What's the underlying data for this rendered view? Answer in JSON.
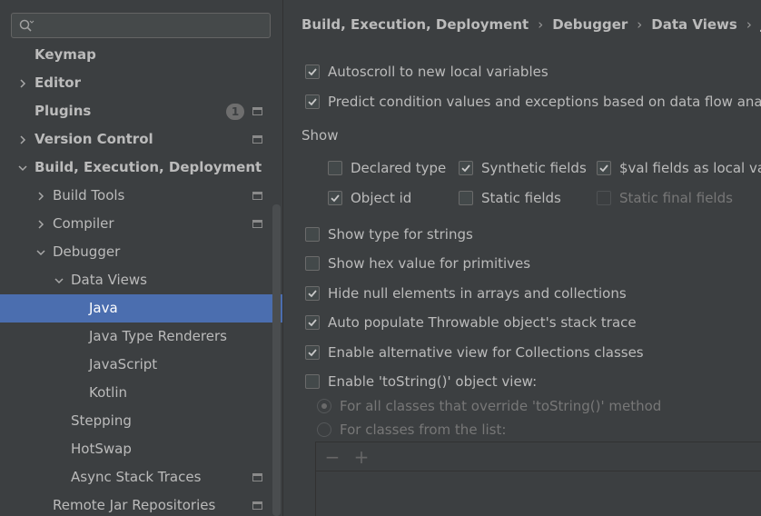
{
  "sidebar": {
    "search": {
      "placeholder": "",
      "value": ""
    },
    "items": [
      {
        "label": "Keymap",
        "level": 0,
        "bold": true,
        "chevron": "none",
        "icon": false
      },
      {
        "label": "Editor",
        "level": 0,
        "bold": true,
        "chevron": "right",
        "icon": false
      },
      {
        "label": "Plugins",
        "level": 0,
        "bold": true,
        "chevron": "none",
        "badge": "1",
        "icon": true
      },
      {
        "label": "Version Control",
        "level": 0,
        "bold": true,
        "chevron": "right",
        "icon": true
      },
      {
        "label": "Build, Execution, Deployment",
        "level": 0,
        "bold": true,
        "chevron": "down",
        "icon": false
      },
      {
        "label": "Build Tools",
        "level": 1,
        "bold": false,
        "chevron": "right",
        "icon": true
      },
      {
        "label": "Compiler",
        "level": 1,
        "bold": false,
        "chevron": "right",
        "icon": true
      },
      {
        "label": "Debugger",
        "level": 1,
        "bold": false,
        "chevron": "down",
        "icon": false
      },
      {
        "label": "Data Views",
        "level": 2,
        "bold": false,
        "chevron": "down",
        "icon": false
      },
      {
        "label": "Java",
        "level": 3,
        "bold": false,
        "chevron": "none",
        "icon": false,
        "selected": true
      },
      {
        "label": "Java Type Renderers",
        "level": 3,
        "bold": false,
        "chevron": "none",
        "icon": false
      },
      {
        "label": "JavaScript",
        "level": 3,
        "bold": false,
        "chevron": "none",
        "icon": false
      },
      {
        "label": "Kotlin",
        "level": 3,
        "bold": false,
        "chevron": "none",
        "icon": false
      },
      {
        "label": "Stepping",
        "level": 2,
        "bold": false,
        "chevron": "none",
        "icon": false
      },
      {
        "label": "HotSwap",
        "level": 2,
        "bold": false,
        "chevron": "none",
        "icon": false
      },
      {
        "label": "Async Stack Traces",
        "level": 2,
        "bold": false,
        "chevron": "none",
        "icon": true
      },
      {
        "label": "Remote Jar Repositories",
        "level": 1,
        "bold": false,
        "chevron": "none",
        "icon": true
      }
    ]
  },
  "breadcrumb": [
    "Build, Execution, Deployment",
    "Debugger",
    "Data Views",
    "Java"
  ],
  "options_top": [
    {
      "label": "Autoscroll to new local variables",
      "checked": true
    },
    {
      "label": "Predict condition values and exceptions based on data flow analysis",
      "checked": true
    }
  ],
  "show": {
    "title": "Show",
    "items": [
      {
        "label": "Declared type",
        "checked": false,
        "disabled": false
      },
      {
        "label": "Synthetic fields",
        "checked": true,
        "disabled": false
      },
      {
        "label": "$val fields as local variables",
        "checked": true,
        "disabled": false
      },
      {
        "label": "Object id",
        "checked": true,
        "disabled": false
      },
      {
        "label": "Static fields",
        "checked": false,
        "disabled": false
      },
      {
        "label": "Static final fields",
        "checked": false,
        "disabled": true
      }
    ]
  },
  "options_bottom": [
    {
      "label": "Show type for strings",
      "checked": false
    },
    {
      "label": "Show hex value for primitives",
      "checked": false
    },
    {
      "label": "Hide null elements in arrays and collections",
      "checked": true
    },
    {
      "label": "Auto populate Throwable object's stack trace",
      "checked": true
    },
    {
      "label": "Enable alternative view for Collections classes",
      "checked": true
    },
    {
      "label": "Enable 'toString()' object view:",
      "checked": false
    }
  ],
  "tostring_radios": [
    {
      "label": "For all classes that override 'toString()' method",
      "selected": true
    },
    {
      "label": "For classes from the list:",
      "selected": false
    }
  ],
  "list_toolbar": {
    "remove": "−",
    "add": "+"
  },
  "colors": {
    "background": "#3c3f41",
    "selection": "#4b6eaf",
    "text": "#bbbbbb",
    "disabled_text": "#777777"
  }
}
